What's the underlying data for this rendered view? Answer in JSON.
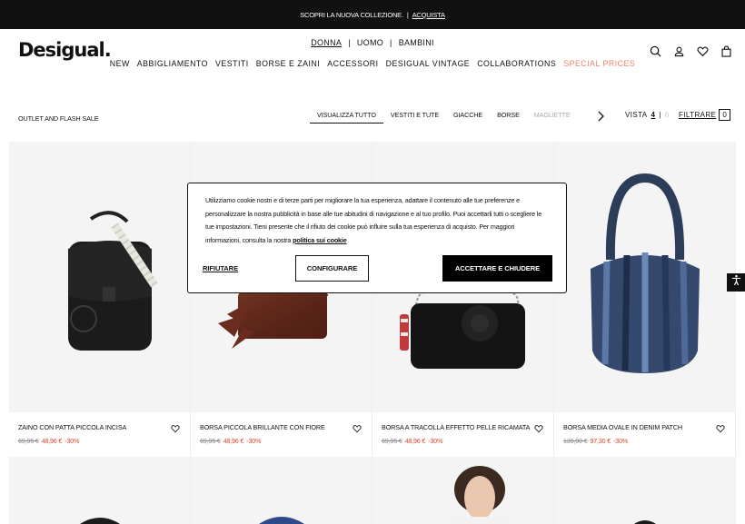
{
  "promo": {
    "text": "SCOPRI LA NUOVA COLLEZIONE.",
    "separator": "|",
    "link": "ACQUISTA"
  },
  "header": {
    "logo": "Desigual.",
    "gender_tabs": [
      "DONNA",
      "UOMO",
      "BAMBINI"
    ],
    "gender_sep": "|",
    "nav": [
      "NEW",
      "ABBIGLIAMENTO",
      "VESTITI",
      "BORSE E ZAINI",
      "ACCESSORI",
      "DESIGUAL VINTAGE",
      "COLLABORATIONS",
      "SPECIAL PRICES"
    ],
    "icons": [
      "search-icon",
      "user-icon",
      "heart-icon",
      "bag-icon"
    ]
  },
  "toolbar": {
    "breadcrumb": "OUTLET AND FLASH SALE",
    "categories": [
      "VISUALIZZA TUTTO",
      "VESTITI E TUTE",
      "GIACCHE",
      "BORSE",
      "MAGLIETTE"
    ],
    "vista_label": "VISTA",
    "vista_active": "4",
    "vista_sep": "|",
    "vista_other": "6",
    "filter_label": "FILTRARE",
    "filter_count": "0"
  },
  "products": [
    {
      "name": "ZAINO CON PATTA PICCOLA INCISA",
      "old_price": "69,95 €",
      "new_price": "48,96 €",
      "discount": "-30%"
    },
    {
      "name": "BORSA PICCOLA BRILLANTE CON FIORE",
      "old_price": "69,95 €",
      "new_price": "48,96 €",
      "discount": "-30%"
    },
    {
      "name": "BORSA A TRACOLLA EFFETTO PELLE RICAMATA",
      "old_price": "69,95 €",
      "new_price": "48,96 €",
      "discount": "-30%"
    },
    {
      "name": "BORSA MEDIA OVALE IN DENIM PATCH",
      "old_price": "139,00 €",
      "new_price": "97,30 €",
      "discount": "-30%"
    }
  ],
  "cookie": {
    "text": "Utilizziamo cookie nostri e di terze parti per migliorare la tua esperienza, adattare il contenuto alle tue preferenze e personalizzare la nostra pubblicità in base alle tue abitudini di navigazione e al tuo profilo. Puoi accettarli tutti o scegliere le tue impostazioni. Tieni presente che il rifiuto dei cookie può influire sulla tua esperienza di acquisto. Per maggiori informazioni, consulta la nostra",
    "link": "politica sui cookie",
    "reject": "RIFIUTARE",
    "configure": "CONFIGURARE",
    "accept": "ACCETTARE E CHIUDERE"
  },
  "colors": {
    "special": "#f0816d",
    "sale": "#e0452e",
    "dark": "#111111"
  }
}
